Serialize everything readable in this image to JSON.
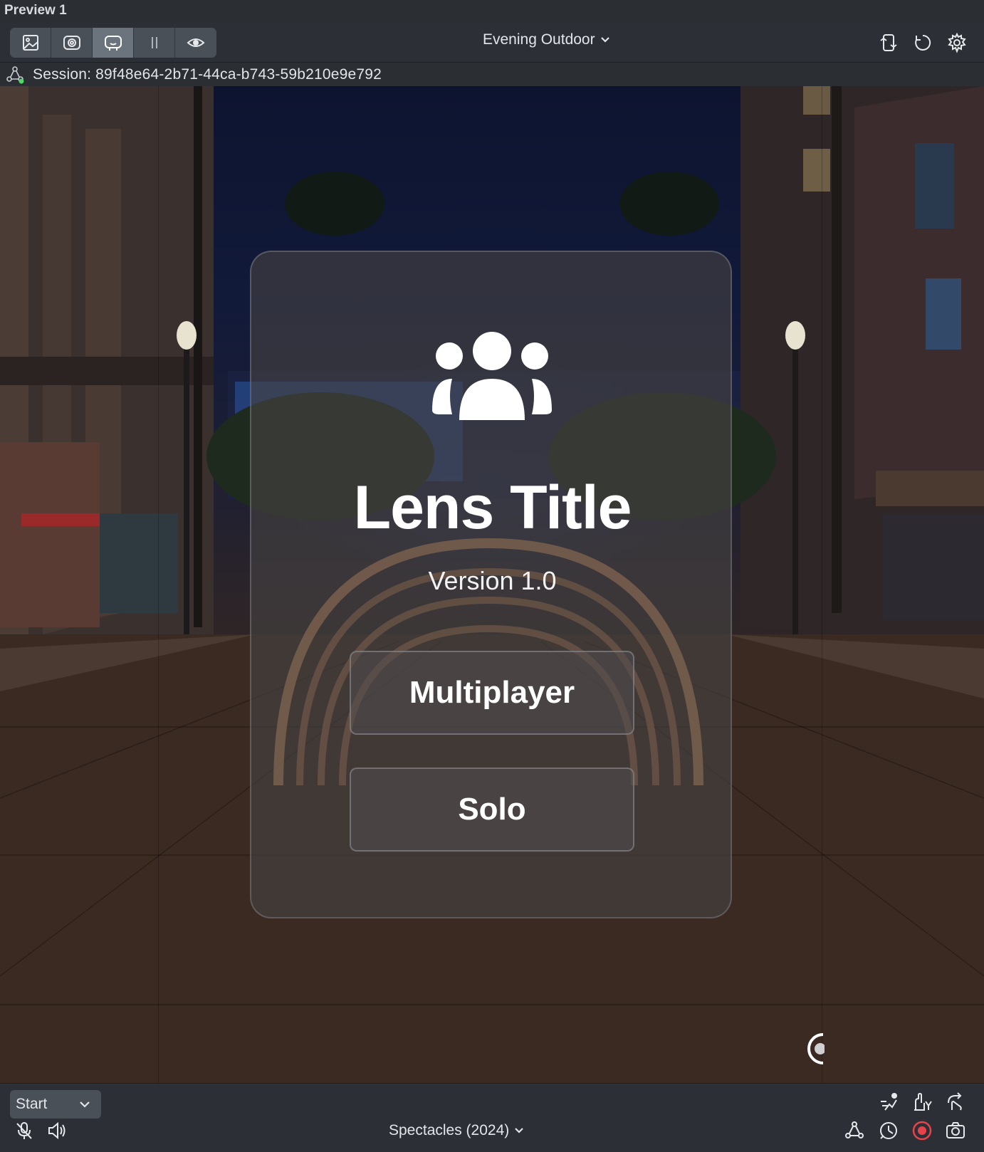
{
  "panel": {
    "title": "Preview 1"
  },
  "toolbar": {
    "view_modes": [
      {
        "name": "image-view-icon",
        "active": false
      },
      {
        "name": "camera-view-icon",
        "active": false
      },
      {
        "name": "interactive-preview-icon",
        "active": true
      },
      {
        "name": "pause-icon",
        "active": false
      },
      {
        "name": "eye-icon",
        "active": false
      }
    ],
    "environment": "Evening Outdoor",
    "right_actions": [
      "reset-device-icon",
      "refresh-icon",
      "settings-gear-icon"
    ]
  },
  "session": {
    "label": "Session: 89f48e64-2b71-44ca-b743-59b210e9e792"
  },
  "lens_card": {
    "icon": "group-users-icon",
    "title": "Lens Title",
    "version": "Version 1.0",
    "buttons": {
      "multiplayer": "Multiplayer",
      "solo": "Solo"
    }
  },
  "bottom": {
    "start_option": "Start",
    "device": "Spectacles (2024)",
    "left_icons": [
      "microphone-muted-icon",
      "speaker-icon"
    ],
    "right_icons_top": [
      "motion-icon",
      "hand-tracking-icon",
      "gesture-icon"
    ],
    "right_icons_bottom": [
      "connected-lens-icon",
      "snapshot-timer-icon",
      "record-icon",
      "camera-icon"
    ]
  },
  "colors": {
    "record": "#e8424a",
    "session_online": "#4cd964",
    "bar_bg": "#2c3036"
  }
}
